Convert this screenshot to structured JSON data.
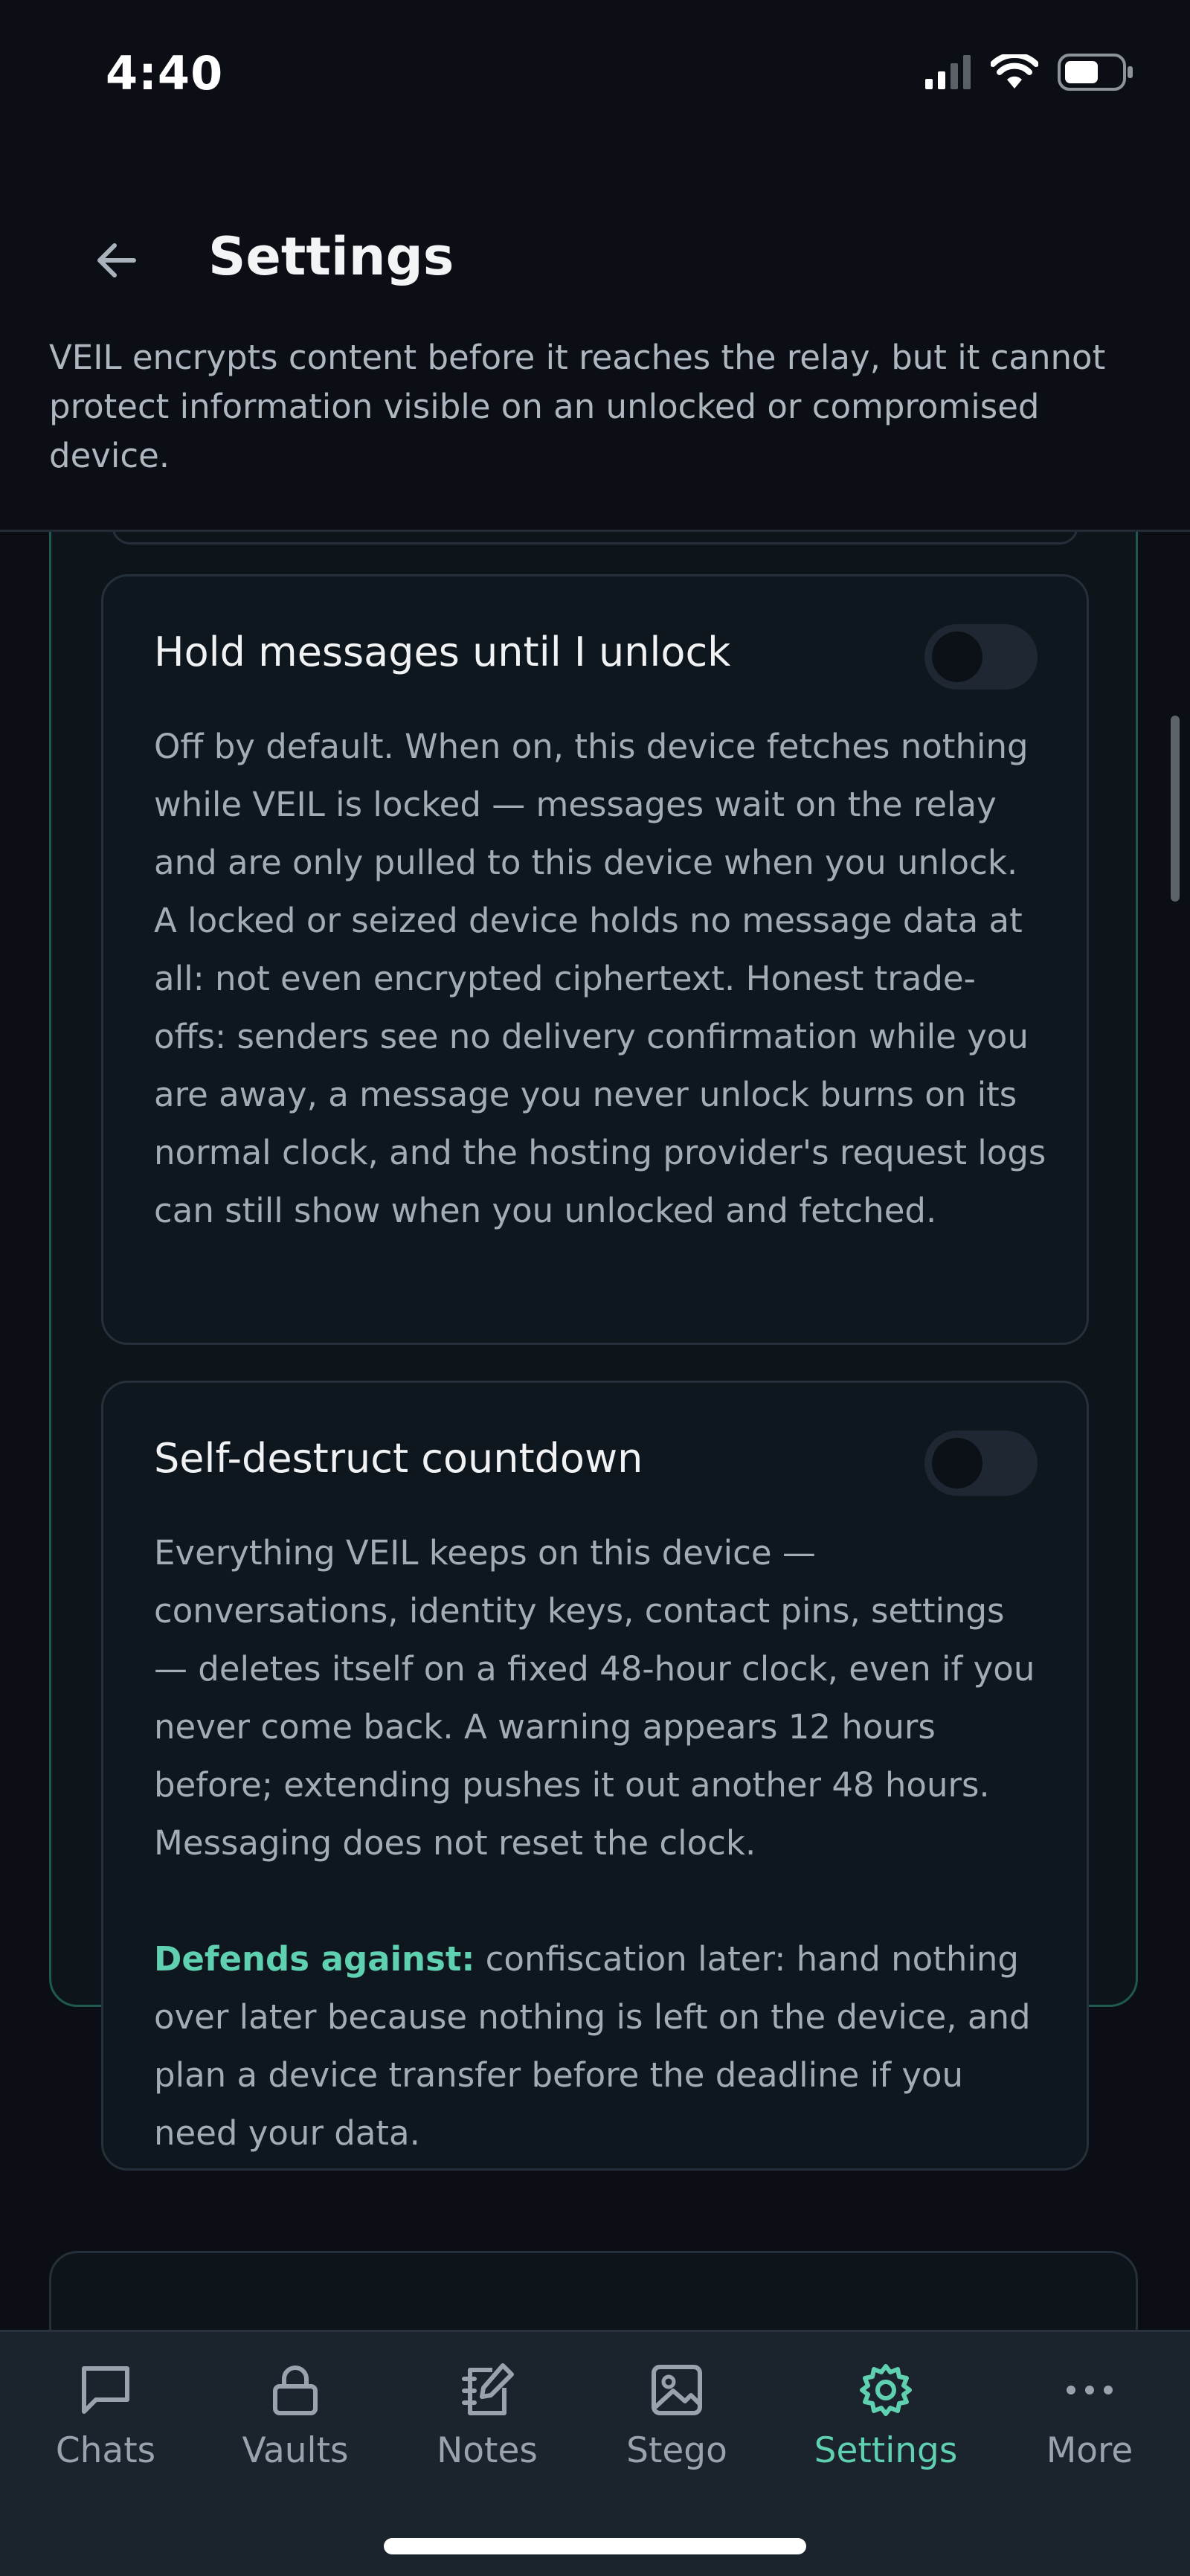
{
  "status_bar": {
    "time": "4:40",
    "icons": [
      "cellular-signal-icon",
      "wifi-icon",
      "battery-icon"
    ]
  },
  "header": {
    "back_icon": "arrow-left-icon",
    "title": "Settings",
    "description": "VEIL encrypts content before it reaches the relay, but it cannot protect information visible on an unlocked or compromised device."
  },
  "options": [
    {
      "title": "Hold messages until I unlock",
      "enabled": false,
      "body": "Off by default. When on, this device fetches nothing while VEIL is locked — messages wait on the relay and are only pulled to this device when you unlock. A locked or seized device holds no message data at all: not even encrypted ciphertext. Honest trade-offs: senders see no delivery confirmation while you are away, a message you never unlock burns on its normal clock, and the hosting provider's request logs can still show when you unlocked and fetched."
    },
    {
      "title": "Self-destruct countdown",
      "enabled": false,
      "body": "Everything VEIL keeps on this device — conversations, identity keys, contact pins, settings — deletes itself on a fixed 48-hour clock, even if you never come back. A warning appears 12 hours before; extending pushes it out another 48 hours. Messaging does not reset the clock.",
      "defends_label": "Defends against:",
      "defends_text": " confiscation later: hand nothing over later because nothing is left on the device, and plan a device transfer before the deadline if you need your data."
    }
  ],
  "tab_bar": {
    "active": "Settings",
    "accent_color": "#5fd0b0",
    "tabs": [
      {
        "label": "Chats",
        "icon": "chat-bubble-icon"
      },
      {
        "label": "Vaults",
        "icon": "lock-icon"
      },
      {
        "label": "Notes",
        "icon": "note-edit-icon"
      },
      {
        "label": "Stego",
        "icon": "image-icon"
      },
      {
        "label": "Settings",
        "icon": "gear-icon"
      },
      {
        "label": "More",
        "icon": "more-dots-icon"
      }
    ]
  }
}
